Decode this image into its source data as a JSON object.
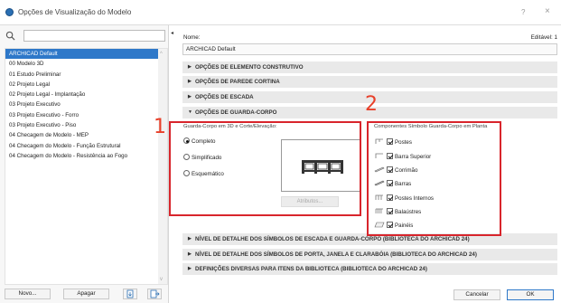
{
  "window": {
    "title": "Opções de Visualização do Modelo",
    "help": "?",
    "close": "×"
  },
  "left": {
    "search_placeholder": "",
    "items": [
      {
        "label": "ARCHICAD Default",
        "selected": true
      },
      {
        "label": "00 Modelo 3D"
      },
      {
        "label": "01 Estudo Preliminar"
      },
      {
        "label": "02 Projeto Legal"
      },
      {
        "label": "02 Projeto Legal - Implantação"
      },
      {
        "label": "03 Projeto Executivo"
      },
      {
        "label": "03 Projeto Executivo - Forro"
      },
      {
        "label": "03 Projeto Executivo - Piso"
      },
      {
        "label": "04 Checagem de Modelo - MEP"
      },
      {
        "label": "04 Checagem do Modelo - Função Estrutural"
      },
      {
        "label": "04 Checagem do Modelo - Resistência ao Fogo"
      }
    ],
    "novo": "Novo...",
    "apagar": "Apagar"
  },
  "right": {
    "name_label": "Nome:",
    "editable": "Editável: 1",
    "name_value": "ARCHICAD Default",
    "sections_top": [
      "OPÇÕES DE ELEMENTO CONSTRUTIVO",
      "OPÇÕES DE PAREDE CORTINA",
      "OPÇÕES DE ESCADA",
      "OPÇÕES DE GUARDA-CORPO"
    ],
    "railing": {
      "left_title": "Guarda-Corpo em 3D e Corte/Elevação:",
      "radios": [
        "Completo",
        "Simplificado",
        "Esquemático"
      ],
      "selected_radio": 0,
      "attr_button": "Atributos...",
      "right_title": "Componentes Símbolo Guarda-Corpo em Planta",
      "checks": [
        "Postes",
        "Barra Superior",
        "Corrimão",
        "Barras",
        "Postes Internos",
        "Balaústres",
        "Painéis"
      ]
    },
    "sections_bottom": [
      "NÍVEL DE DETALHE DOS SÍMBOLOS DE ESCADA E GUARDA-CORPO (BIBLIOTECA DO ARCHICAD 24)",
      "NÍVEL DE DETALHE DOS SÍMBOLOS DE PORTA, JANELA E CLARABÓIA (BIBLIOTECA DO ARCHICAD 24)",
      "DEFINIÇÕES DIVERSAS PARA ITENS DA BIBLIOTECA (BIBLIOTECA DO ARCHICAD 24)"
    ],
    "cancel": "Cancelar",
    "ok": "OK"
  },
  "annotations": {
    "n1": "1",
    "n2": "2",
    "color": "#d8252c"
  }
}
